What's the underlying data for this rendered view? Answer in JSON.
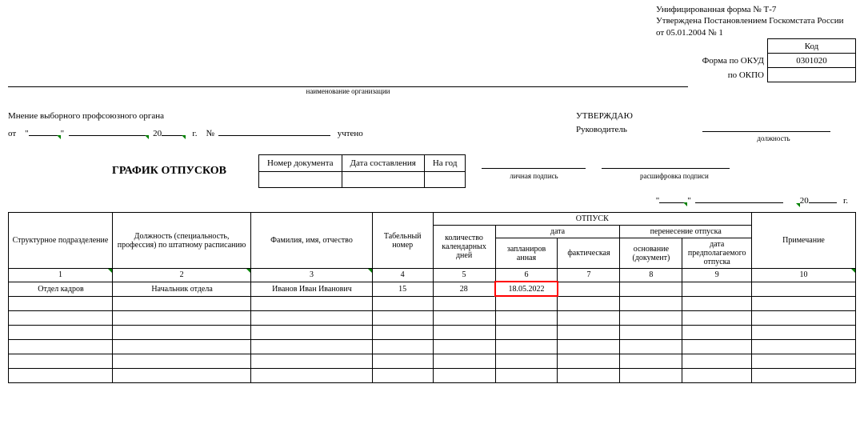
{
  "header": {
    "line1": "Унифицированная форма № Т-7",
    "line2": "Утверждена Постановлением Госкомстата России",
    "line3": "от 05.01.2004 № 1"
  },
  "okud": {
    "kod": "Код",
    "okud_label": "Форма по ОКУД",
    "okud_val": "0301020",
    "okpo_label": "по ОКПО",
    "okpo_val": ""
  },
  "org_caption": "наименование организации",
  "mnenie": {
    "title": "Мнение выборного профсоюзного органа",
    "ot": "от",
    "year20": "20",
    "g": "г.",
    "num": "№",
    "uchteno": "учтено"
  },
  "utv": {
    "title": "УТВЕРЖДАЮ",
    "ruk": "Руководитель",
    "dolzh": "должность",
    "lp": "личная подпись",
    "rasch": "расшифровка подписи",
    "year20": "20",
    "g": "г."
  },
  "maintitle": "ГРАФИК ОТПУСКОВ",
  "docnum": {
    "h1": "Номер документа",
    "h2": "Дата составления",
    "h3": "На год"
  },
  "colhead": {
    "c1": "Структурное подразделение",
    "c2": "Должность (специальность, профессия) по штатному расписанию",
    "c3": "Фамилия, имя, отчество",
    "c4": "Табельный номер",
    "otpusk": "ОТПУСК",
    "c5": "количество календарных дней",
    "data": "дата",
    "c6": "запланиров анная",
    "c7": "фактическая",
    "perenos": "перенесение отпуска",
    "c8": "основание (документ)",
    "c9": "дата предполагаемого отпуска",
    "c10": "Примечание"
  },
  "nums": {
    "n1": "1",
    "n2": "2",
    "n3": "3",
    "n4": "4",
    "n5": "5",
    "n6": "6",
    "n7": "7",
    "n8": "8",
    "n9": "9",
    "n10": "10"
  },
  "row1": {
    "c1": "Отдел кадров",
    "c2": "Начальник отдела",
    "c3": "Иванов Иван Иванович",
    "c4": "15",
    "c5": "28",
    "c6": "18.05.2022",
    "c7": "",
    "c8": "",
    "c9": "",
    "c10": ""
  },
  "quote": "\""
}
